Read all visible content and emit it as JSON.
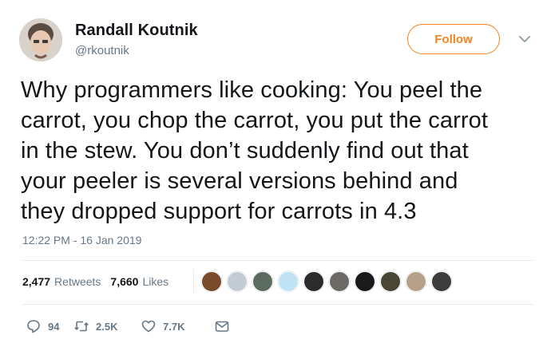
{
  "author": {
    "name": "Randall Koutnik",
    "handle": "@rkoutnik"
  },
  "follow_label": "Follow",
  "tweet": {
    "text": "Why programmers like cooking:  You peel the\ncarrot, you chop the carrot, you put the carrot\nin the stew.  You don’t suddenly find out that\nyour peeler is several versions behind and\nthey dropped support for carrots in 4.3",
    "timestamp": "12:22 PM - 16 Jan 2019"
  },
  "stats": {
    "retweets_count": "2,477",
    "retweets_label": "Retweets",
    "likes_count": "7,660",
    "likes_label": "Likes"
  },
  "likers": [
    {
      "name": "liker-avatar-1",
      "color": "#7a4a2c"
    },
    {
      "name": "liker-avatar-2",
      "color": "#c3ccd4"
    },
    {
      "name": "liker-avatar-3",
      "color": "#5b6b5e"
    },
    {
      "name": "liker-avatar-4",
      "color": "#bfe3f5"
    },
    {
      "name": "liker-avatar-5",
      "color": "#2b2b2b"
    },
    {
      "name": "liker-avatar-6",
      "color": "#6d6a66"
    },
    {
      "name": "liker-avatar-7",
      "color": "#1a1a1a"
    },
    {
      "name": "liker-avatar-8",
      "color": "#4a4636"
    },
    {
      "name": "liker-avatar-9",
      "color": "#b7a08a"
    },
    {
      "name": "liker-avatar-10",
      "color": "#3c3c3c"
    }
  ],
  "actions": {
    "replies": "94",
    "retweets": "2.5K",
    "likes": "7.7K"
  },
  "colors": {
    "accent": "#f5821f",
    "muted": "#657786",
    "text": "#14171a",
    "divider": "#e6ecf0"
  }
}
